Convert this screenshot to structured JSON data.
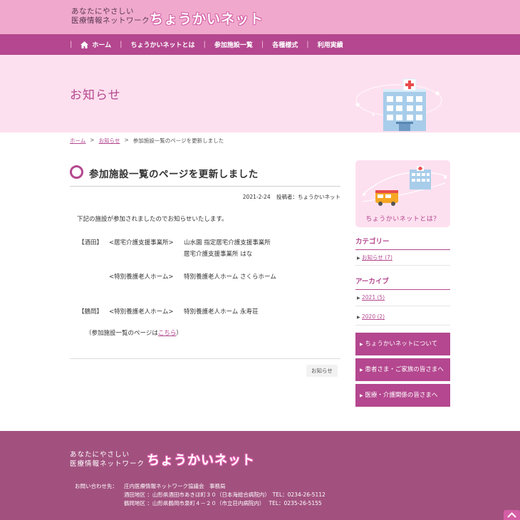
{
  "header": {
    "logo_line1": "あなたにやさしい",
    "logo_line2": "医療情報ネットワーク",
    "logo_brand": "ちょうかいネット"
  },
  "nav": {
    "items": [
      {
        "label": "ホーム",
        "icon": "home-icon"
      },
      {
        "label": "ちょうかいネットとは"
      },
      {
        "label": "参加施設一覧"
      },
      {
        "label": "各種様式"
      },
      {
        "label": "利用実績"
      }
    ]
  },
  "hero": {
    "title": "お知らせ"
  },
  "breadcrumb": {
    "home": "ホーム",
    "sep": ">",
    "section": "お知らせ",
    "current": "参加施設一覧のページを更新しました"
  },
  "article": {
    "title": "参加施設一覧のページを更新しました",
    "date": "2021-2-24",
    "author": "投稿者：ちょうかいネット",
    "intro": "下記の施設が参加されましたのでお知らせいたします。",
    "rows": [
      {
        "area": "【酒田】",
        "type": "<居宅介護支援事業所>",
        "name": "山水園 指定居宅介護支援事業所"
      },
      {
        "area": "",
        "type": "",
        "name": "居宅介護支援事業所 はな"
      },
      {
        "area": "",
        "type": "<特別養護老人ホーム>",
        "name": "特別養護老人ホーム さくらホーム"
      },
      {
        "area": "【鶴岡】",
        "type": "<特別養護老人ホーム>",
        "name": "特別養護老人ホーム 永寿荘"
      }
    ],
    "note_prefix": "（参加施設一覧のページは",
    "note_link": "こちら",
    "note_suffix": "）",
    "tag": "お知らせ"
  },
  "sidebar": {
    "banner_label": "ちょうかいネットとは？",
    "category_heading": "カテゴリー",
    "categories": [
      {
        "label": "お知らせ (7)"
      }
    ],
    "archive_heading": "アーカイブ",
    "archives": [
      {
        "label": "2021 (5)"
      },
      {
        "label": "2020 (2)"
      }
    ],
    "arrow": "▶",
    "buttons": [
      {
        "label": "ちょうかいネットについて"
      },
      {
        "label": "患者さま・ご家族の皆さまへ"
      },
      {
        "label": "医療・介護関係の皆さまへ"
      }
    ]
  },
  "footer": {
    "logo_line1": "あなたにやさしい",
    "logo_line2": "医療情報ネットワーク",
    "logo_brand": "ちょうかいネット",
    "contact_label": "お問い合わせ先：",
    "org": "庄内医療情報ネットワーク協議会　事務局",
    "sakata": "酒田地区 ：山形県酒田市あきほ町３０（日本海総合病院内）　TEL：0234-26-5112",
    "tsuruoka": "鶴岡地区 ：山形県鶴岡市泉町４－２０（市立荘内病院内）　 TEL：0235-26-5155"
  },
  "colors": {
    "accent": "#b4478f",
    "header_pink": "#f0a9cd",
    "hero_pink": "#fde0ef",
    "footer": "#a2517f"
  }
}
